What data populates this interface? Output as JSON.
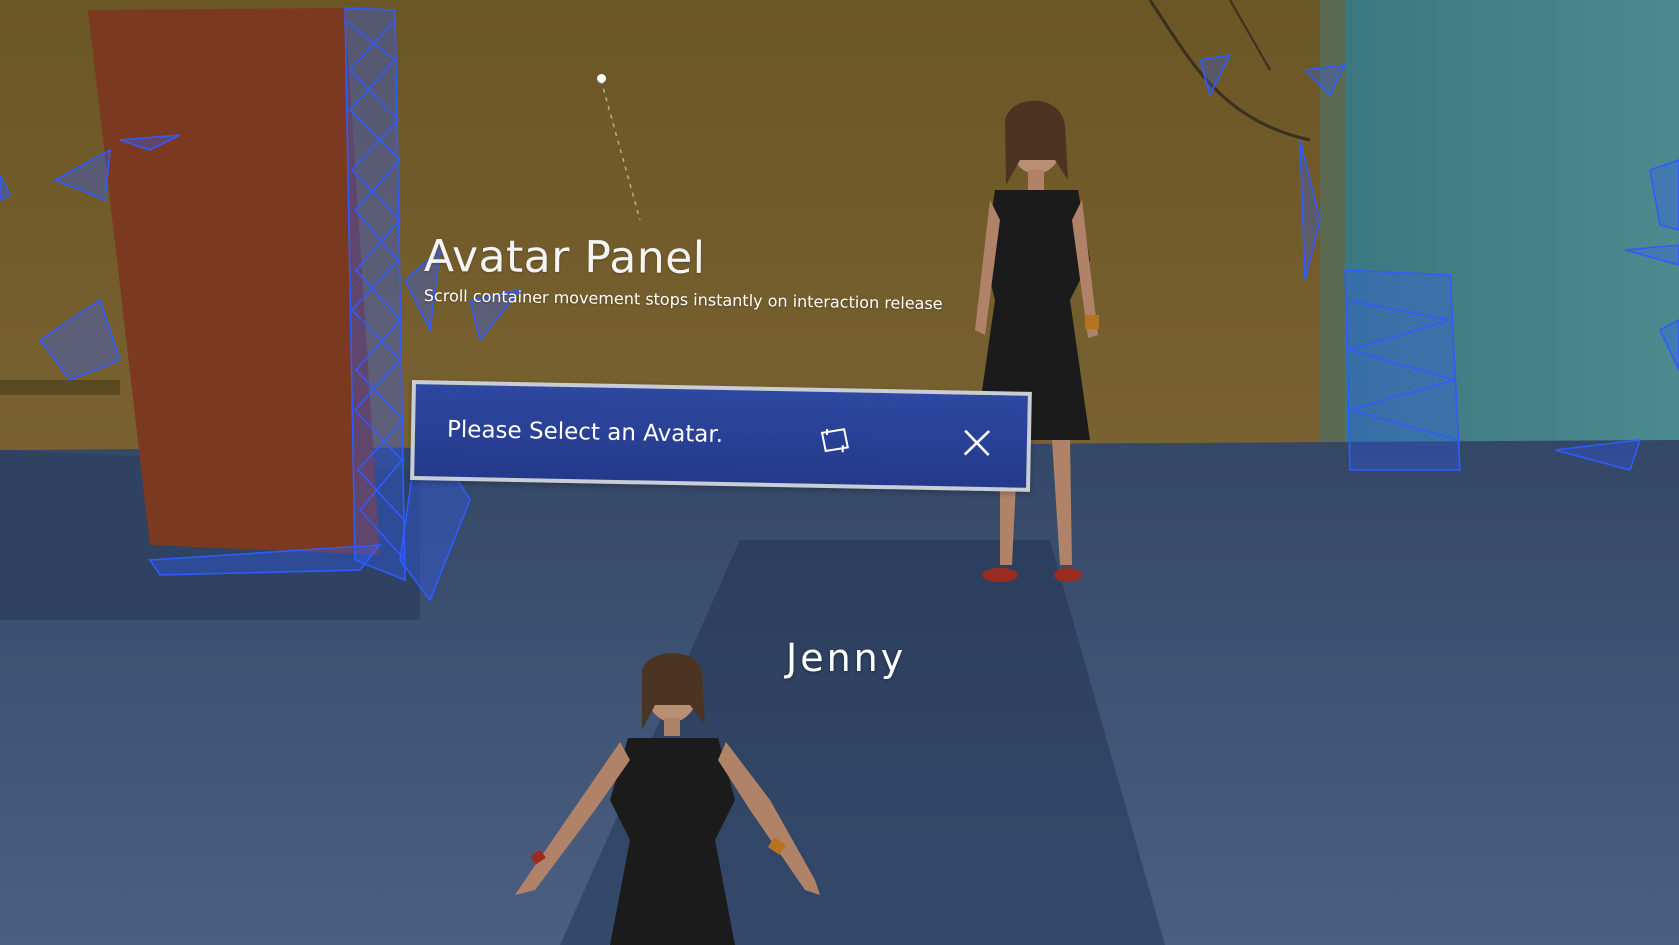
{
  "scene": {
    "panel_title": "Avatar Panel",
    "panel_subtitle": "Scroll container movement stops instantly on interaction release"
  },
  "dialog": {
    "message": "Please Select an Avatar.",
    "pin_icon": "pin-icon",
    "close_icon": "close-icon"
  },
  "avatar": {
    "name": "Jenny"
  },
  "colors": {
    "dialog_bg": "#2a4399",
    "dialog_border": "#c8cdd6",
    "wall": "#6e5a2a",
    "floor": "#3b4f70",
    "mesh": "#2f5bff",
    "door": "#7a3a1e",
    "right_room": "#3f7f86"
  }
}
